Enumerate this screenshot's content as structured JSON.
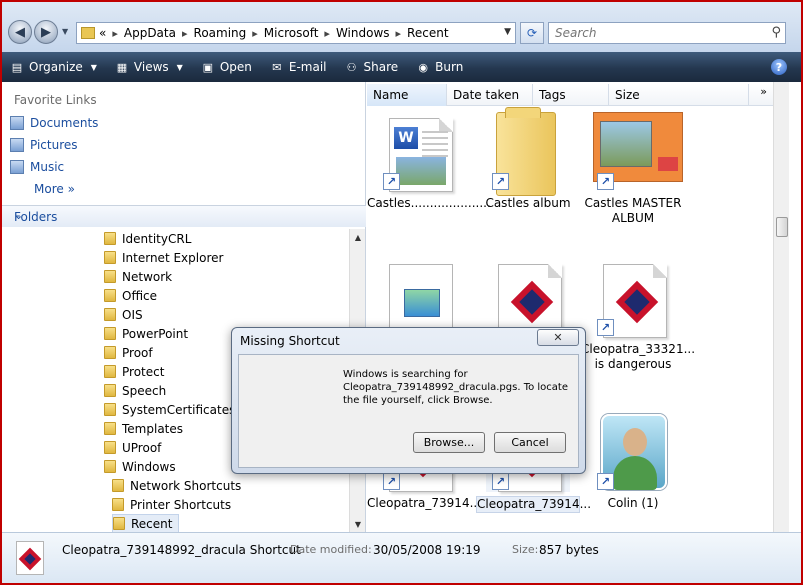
{
  "address": {
    "crumbs": [
      "AppData",
      "Roaming",
      "Microsoft",
      "Windows",
      "Recent"
    ],
    "overflow": "«",
    "search_placeholder": "Search"
  },
  "toolbar": {
    "organize": "Organize",
    "views": "Views",
    "open": "Open",
    "email": "E-mail",
    "share": "Share",
    "burn": "Burn"
  },
  "nav": {
    "favorites_header": "Favorite Links",
    "favorites": [
      "Documents",
      "Pictures",
      "Music"
    ],
    "more": "More",
    "folders_header": "Folders",
    "tree": [
      {
        "label": "IdentityCRL",
        "indent": 0
      },
      {
        "label": "Internet Explorer",
        "indent": 0
      },
      {
        "label": "Network",
        "indent": 0
      },
      {
        "label": "Office",
        "indent": 0
      },
      {
        "label": "OIS",
        "indent": 0
      },
      {
        "label": "PowerPoint",
        "indent": 0
      },
      {
        "label": "Proof",
        "indent": 0
      },
      {
        "label": "Protect",
        "indent": 0
      },
      {
        "label": "Speech",
        "indent": 0
      },
      {
        "label": "SystemCertificates",
        "indent": 0
      },
      {
        "label": "Templates",
        "indent": 0
      },
      {
        "label": "UProof",
        "indent": 0
      },
      {
        "label": "Windows",
        "indent": 0
      },
      {
        "label": "Network Shortcuts",
        "indent": 1
      },
      {
        "label": "Printer Shortcuts",
        "indent": 1
      },
      {
        "label": "Recent",
        "indent": 1,
        "selected": true
      }
    ]
  },
  "columns": [
    "Name",
    "Date taken",
    "Tags",
    "Size"
  ],
  "files": [
    {
      "caption": "Castles.....................",
      "icon": "word-doc"
    },
    {
      "caption": "Castles album",
      "icon": "folder"
    },
    {
      "caption": "Castles MASTER ALBUM",
      "icon": "powerpoint"
    },
    {
      "caption": "",
      "icon": "mail-doc"
    },
    {
      "caption": "",
      "icon": "pgs-doc"
    },
    {
      "caption": "Cleopatra_33321... is dangerous",
      "icon": "pgs-doc"
    },
    {
      "caption": "Cleopatra_73914...",
      "icon": "pgs-doc"
    },
    {
      "caption": "Cleopatra_73914...",
      "icon": "pgs-doc",
      "highlighted": true
    },
    {
      "caption": "Colin  (1)",
      "icon": "user-avatar"
    }
  ],
  "dialog": {
    "title": "Missing Shortcut",
    "close": "✕",
    "message": "Windows is searching for Cleopatra_739148992_dracula.pgs. To locate the file yourself, click Browse.",
    "browse": "Browse...",
    "cancel": "Cancel"
  },
  "details": {
    "name": "Cleopatra_739148992_dracula Shortcut",
    "date_label": "Date modified:",
    "date_value": "30/05/2008 19:19",
    "size_label": "Size:",
    "size_value": "857 bytes"
  }
}
